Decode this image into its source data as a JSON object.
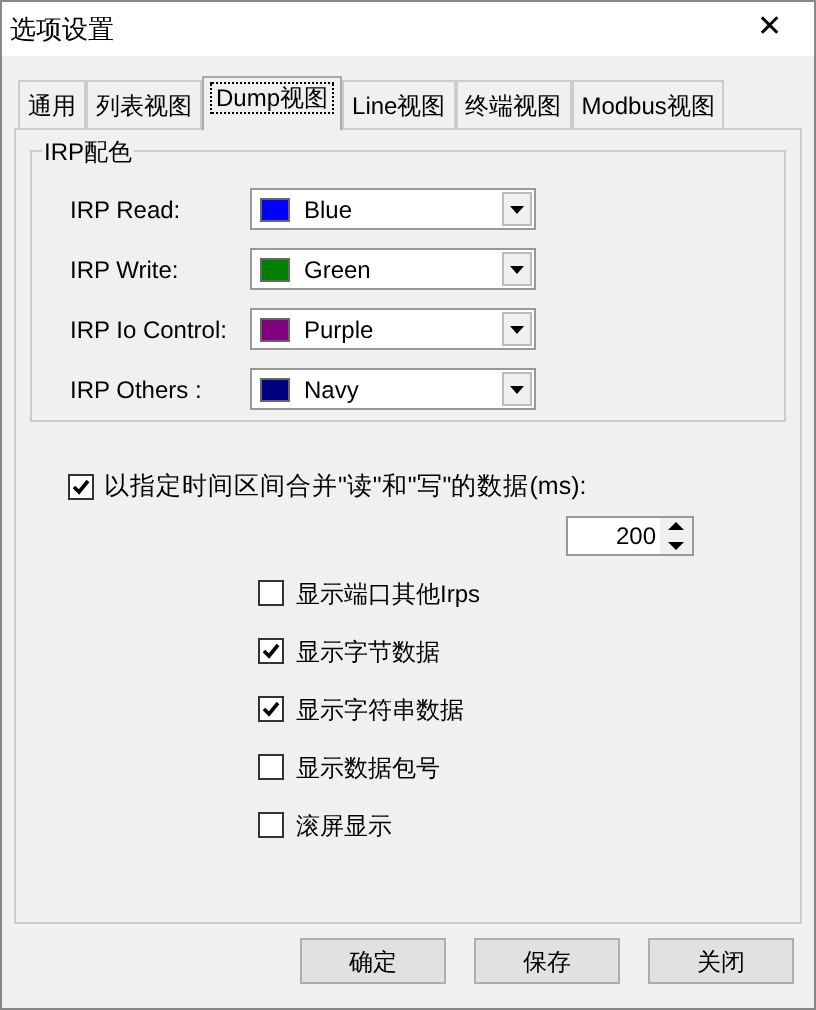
{
  "window": {
    "title": "选项设置",
    "close": "✕"
  },
  "tabs": [
    {
      "label": "通用",
      "selected": false
    },
    {
      "label": "列表视图",
      "selected": false
    },
    {
      "label": "Dump视图",
      "selected": true
    },
    {
      "label": "Line视图",
      "selected": false
    },
    {
      "label": "终端视图",
      "selected": false
    },
    {
      "label": "Modbus视图",
      "selected": false
    }
  ],
  "irp_colors": {
    "title": "IRP配色",
    "rows": [
      {
        "label": "IRP Read:",
        "value": "Blue",
        "color": "#0000ff"
      },
      {
        "label": "IRP Write:",
        "value": "Green",
        "color": "#008000"
      },
      {
        "label": "IRP Io Control:",
        "value": "Purple",
        "color": "#800080"
      },
      {
        "label": "IRP Others :",
        "value": "Navy",
        "color": "#000080"
      }
    ]
  },
  "merge": {
    "label": "以指定时间区间合并\"读\"和\"写\"的数据(ms):",
    "checked": true,
    "value": "200"
  },
  "options": [
    {
      "label": "显示端口其他Irps",
      "checked": false
    },
    {
      "label": "显示字节数据",
      "checked": true
    },
    {
      "label": "显示字符串数据",
      "checked": true
    },
    {
      "label": "显示数据包号",
      "checked": false
    },
    {
      "label": "滚屏显示",
      "checked": false
    }
  ],
  "buttons": [
    "确定",
    "保存",
    "关闭"
  ]
}
